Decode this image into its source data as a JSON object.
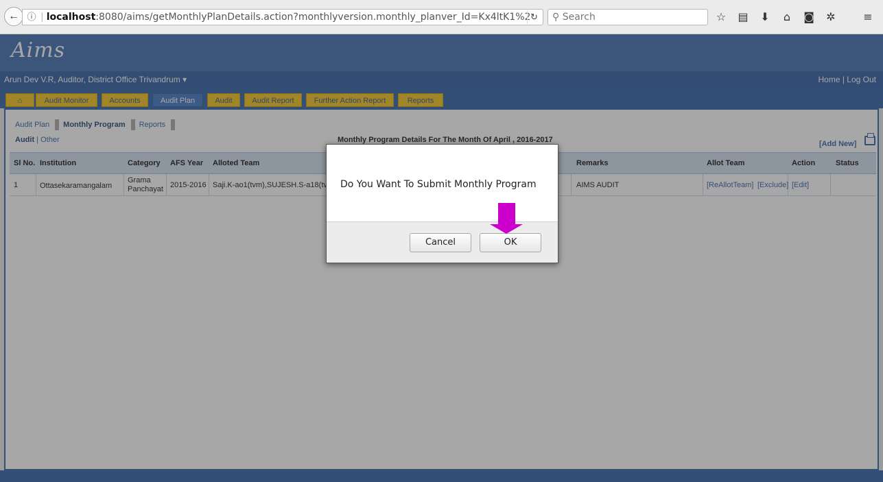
{
  "browser": {
    "url_host": "localhost",
    "url_path": ":8080/aims/getMonthlyPlanDetails.action?monthlyversion.monthly_planver_Id=Kx4ltK1%2",
    "search_placeholder": "Search"
  },
  "site": {
    "logo": "Aims",
    "user_info": "Arun Dev V.R,  Auditor,  District Office Trivandrum ▾",
    "home_link": "Home",
    "logout_link": "Log Out"
  },
  "nav": {
    "tabs": [
      "Audit Monitor",
      "Accounts",
      "Audit Plan",
      "Audit",
      "Audit Report",
      "Further Action Report",
      "Reports"
    ],
    "active": "Audit Plan"
  },
  "subtabs": {
    "audit_plan": "Audit Plan",
    "monthly_program": "Monthly Program",
    "reports": "Reports",
    "audit": "Audit",
    "other": "Other"
  },
  "page": {
    "title": "Monthly Program Details For The Month Of April , 2016-2017",
    "add_new": "[Add New]"
  },
  "table": {
    "headers": [
      "Sl No.",
      "Institution",
      "Category",
      "AFS Year",
      "Alloted Team",
      "Remarks",
      "Allot Team",
      "Action",
      "Status"
    ],
    "row": {
      "sl": "1",
      "institution": "Ottasekaramangalam",
      "category_1": "Grama",
      "category_2": "Panchayat",
      "afs_year": "2015-2016",
      "team": "Saji.K-ao1(tvm),SUJESH.S-a18(tvm),",
      "remarks": "AIMS AUDIT",
      "reallot": "[ReAllotTeam]",
      "exclude": "[Exclude]",
      "edit": "[Edit]"
    }
  },
  "dialog": {
    "message": "Do You Want To Submit Monthly Program",
    "cancel": "Cancel",
    "ok": "OK"
  },
  "colors": {
    "header_blue": "#3d6bb0",
    "tab_yellow": "#f4c21b",
    "annotation_arrow": "#cc00cc"
  }
}
